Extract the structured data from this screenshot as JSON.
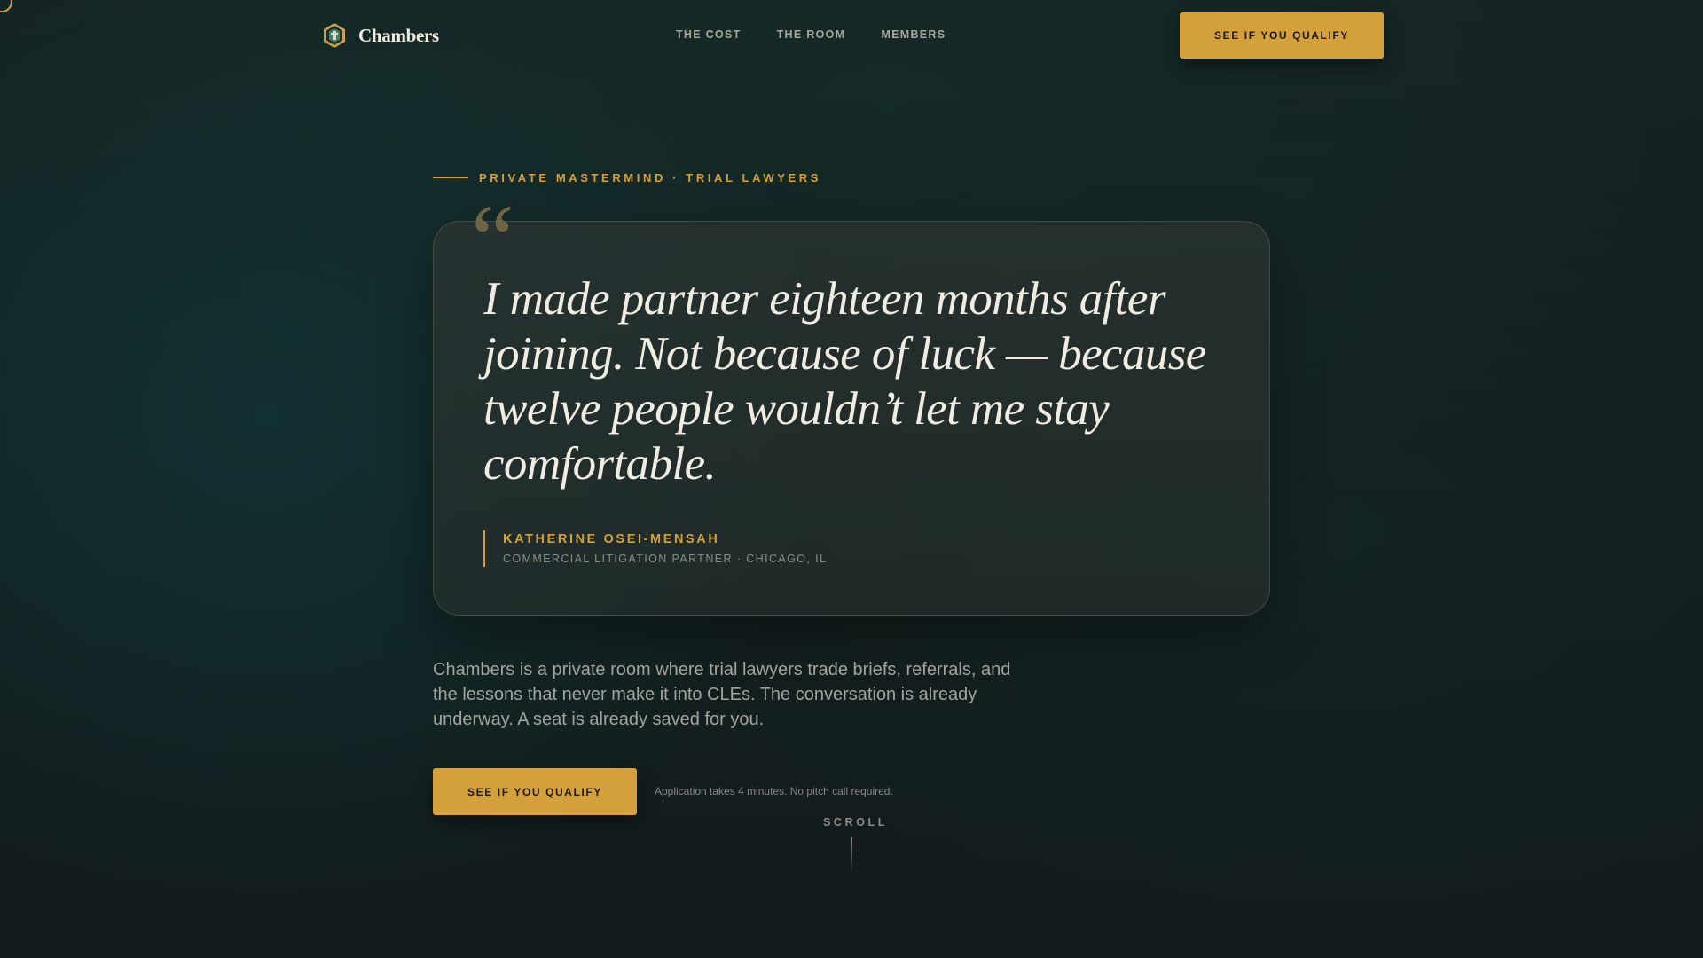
{
  "nav": {
    "brand_name": "Chambers",
    "links": [
      "THE COST",
      "THE ROOM",
      "MEMBERS"
    ],
    "cta_label": "SEE IF YOU QUALIFY"
  },
  "hero": {
    "eyebrow": "PRIVATE MASTERMIND · TRIAL LAWYERS",
    "quote_mark": "“",
    "quote": "I made partner eighteen months after joining. Not because of luck — because twelve people wouldn’t let me stay comfortable.",
    "attribution": {
      "name": "KATHERINE OSEI-MENSAH",
      "role": "COMMERCIAL LITIGATION PARTNER · CHICAGO, IL"
    },
    "lede": "Chambers is a private room where trial lawyers trade briefs, referrals, and the lessons that never make it into CLEs. The conversation is already underway. A seat is already saved for you.",
    "cta_label": "SEE IF YOU QUALIFY",
    "cta_note": "Application takes 4 minutes. No pitch call required.",
    "scroll_label": "SCROLL"
  },
  "colors": {
    "accent": "#d4a03c",
    "background": "#14201f",
    "text_primary": "#f1ece1",
    "text_muted": "#a3a49c"
  },
  "icons": {
    "brand": "shield-crest-icon"
  }
}
